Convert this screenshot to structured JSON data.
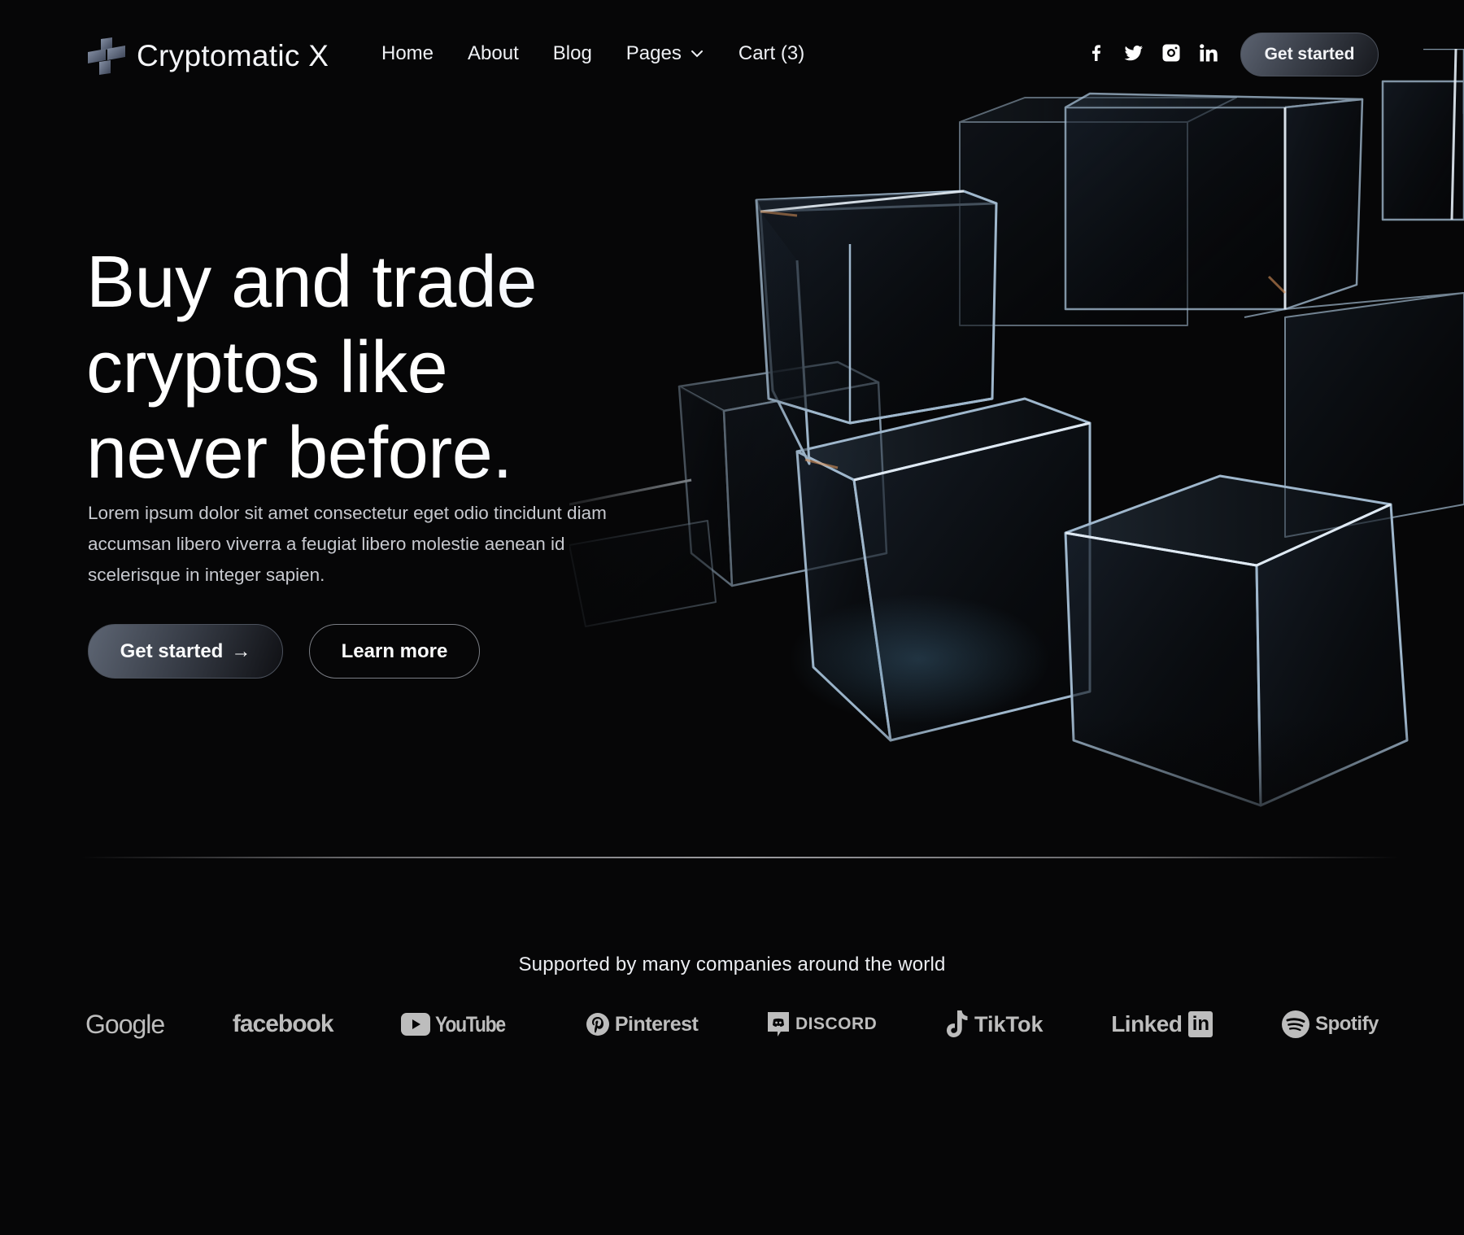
{
  "brand": {
    "name": "Cryptomatic X",
    "logo_icon": "cross-blocks-logo-icon"
  },
  "nav": {
    "items": [
      {
        "label": "Home"
      },
      {
        "label": "About"
      },
      {
        "label": "Blog"
      },
      {
        "label": "Pages",
        "icon": "chevron-down-icon"
      },
      {
        "label": "Cart (3)"
      }
    ]
  },
  "socials": [
    {
      "name": "facebook",
      "icon": "facebook-icon"
    },
    {
      "name": "twitter",
      "icon": "twitter-icon"
    },
    {
      "name": "instagram",
      "icon": "instagram-icon"
    },
    {
      "name": "linkedin",
      "icon": "linkedin-icon"
    }
  ],
  "header": {
    "cta_label": "Get started"
  },
  "hero": {
    "headline_lines": [
      "Buy and trade",
      "cryptos like",
      "never before."
    ],
    "lead": "Lorem ipsum dolor sit amet consectetur eget odio tincidunt diam accumsan libero viverra a feugiat libero molestie aenean id scelerisque in integer sapien.",
    "primary_label": "Get started",
    "primary_icon": "arrow-right-icon",
    "primary_arrow": "→",
    "secondary_label": "Learn more",
    "image": "glass-cubes-illustration"
  },
  "partners": {
    "heading": "Supported by many companies around the world",
    "logos": [
      {
        "name": "Google"
      },
      {
        "name": "facebook"
      },
      {
        "name": "YouTube"
      },
      {
        "name": "Pinterest"
      },
      {
        "name": "DISCORD"
      },
      {
        "name": "TikTok"
      },
      {
        "name": "Linked",
        "suffix": "in"
      },
      {
        "name": "Spotify"
      }
    ]
  },
  "colors": {
    "background": "#060607",
    "text": "#f2f4f8",
    "muted_text": "#c7c9cf",
    "logo_gray": "#bdbdbd",
    "button_gradient_start": "#5d6573",
    "button_gradient_end": "#0f1014"
  }
}
